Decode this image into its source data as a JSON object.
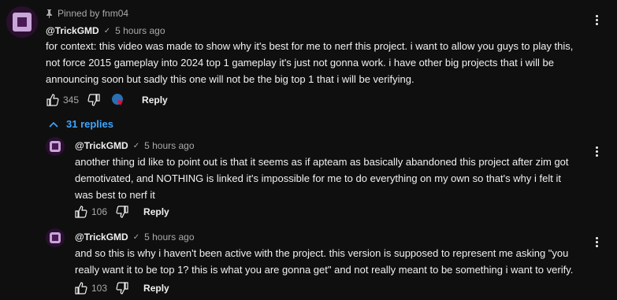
{
  "pinned": {
    "label": "Pinned by fnm04"
  },
  "main_comment": {
    "author": "@TrickGMD",
    "time": "5 hours ago",
    "text": "for context: this video was made to show why it's best for me to nerf this project. i want to allow you guys to play this, not force 2015 gameplay into 2024 top 1 gameplay it's just not gonna work. i have other big projects that i will be announcing soon but sadly this one will not be the big top 1 that i will be verifying.",
    "likes": "345",
    "reply_label": "Reply"
  },
  "replies_toggle": {
    "label": "31 replies"
  },
  "replies": [
    {
      "author": "@TrickGMD",
      "time": "5 hours ago",
      "text": "another thing id like to point out is that it seems as if apteam as basically abandoned this project after zim got demotivated, and NOTHING is linked it's impossible for me to do everything on my own so that's why i felt it was best to nerf it",
      "likes": "106",
      "reply_label": "Reply"
    },
    {
      "author": "@TrickGMD",
      "time": "5 hours ago",
      "text": "and so this is why i haven't been active with the project. this version is supposed to represent me asking \"you really want it to be top 1? this is what you are gonna get\" and not really meant to be something i want to verify.",
      "likes": "103",
      "reply_label": "Reply"
    }
  ],
  "colors": {
    "background": "#0f0f0f",
    "link": "#3ea6ff",
    "muted": "#aaaaaa",
    "text": "#f1f1f1",
    "heart": "#ff0033"
  },
  "icons": [
    "pin-icon",
    "verified-check-icon",
    "like-icon",
    "dislike-icon",
    "creator-heart-icon",
    "chevron-up-icon",
    "more-options-icon"
  ]
}
